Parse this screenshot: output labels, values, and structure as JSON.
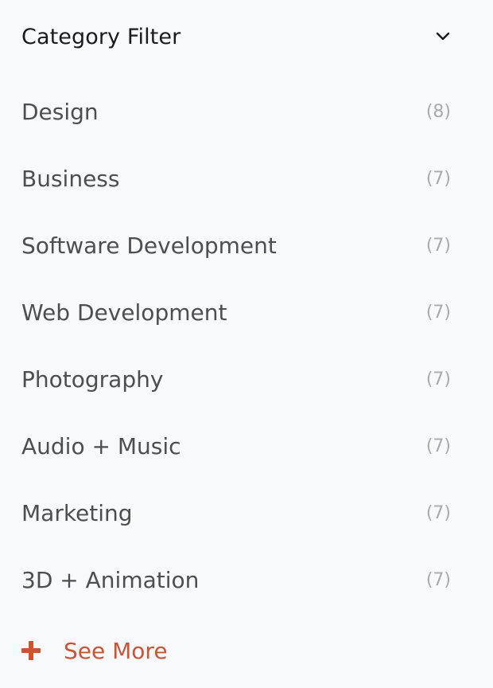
{
  "filter": {
    "title": "Category Filter",
    "toggle_icon": "chevron-down-icon",
    "categories": [
      {
        "label": "Design",
        "count": "(8)"
      },
      {
        "label": "Business",
        "count": "(7)"
      },
      {
        "label": "Software Development",
        "count": "(7)"
      },
      {
        "label": "Web Development",
        "count": "(7)"
      },
      {
        "label": "Photography",
        "count": "(7)"
      },
      {
        "label": "Audio + Music",
        "count": "(7)"
      },
      {
        "label": "Marketing",
        "count": "(7)"
      },
      {
        "label": "3D + Animation",
        "count": "(7)"
      }
    ],
    "see_more": {
      "label": "See More",
      "icon": "plus-icon"
    }
  },
  "colors": {
    "background": "#f8f9fb",
    "title": "#1b1b1b",
    "label": "#4e4e4e",
    "count": "#a9aaad",
    "accent": "#c8553a"
  }
}
